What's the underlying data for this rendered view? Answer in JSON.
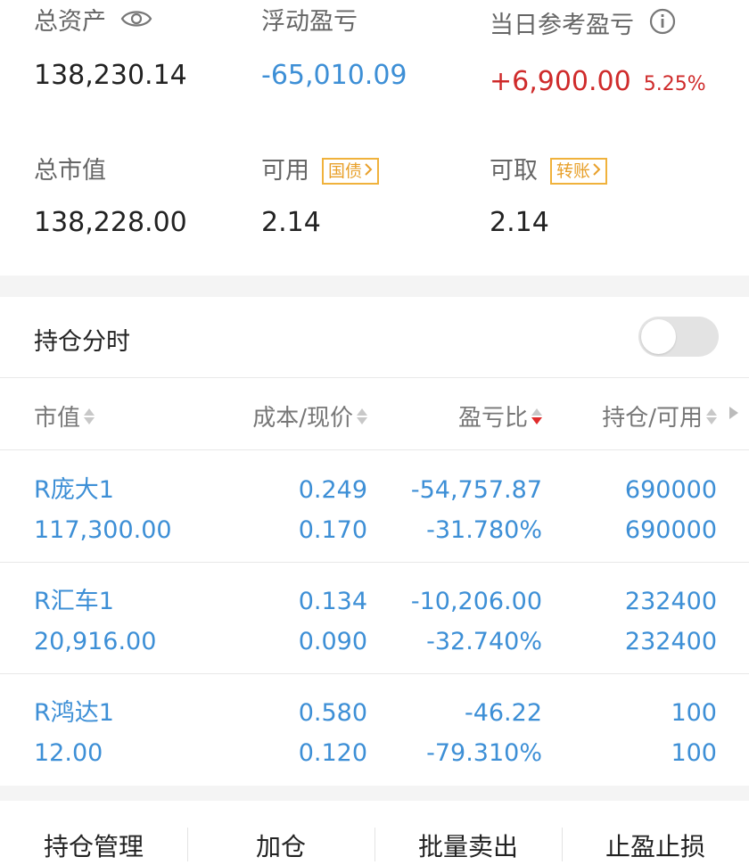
{
  "summary": {
    "total_assets": {
      "label": "总资产",
      "value": "138,230.14"
    },
    "floating_pnl": {
      "label": "浮动盈亏",
      "value": "-65,010.09"
    },
    "daily_pnl": {
      "label": "当日参考盈亏",
      "value": "+6,900.00",
      "percent": "5.25%"
    },
    "market_value": {
      "label": "总市值",
      "value": "138,228.00"
    },
    "available": {
      "label": "可用",
      "value": "2.14",
      "tag": "国债"
    },
    "withdrawable": {
      "label": "可取",
      "value": "2.14",
      "tag": "转账"
    }
  },
  "holdings": {
    "title": "持仓分时",
    "toggle_on": false,
    "headers": [
      "市值",
      "成本/现价",
      "盈亏比",
      "持仓/可用"
    ],
    "rows": [
      {
        "name": "R庞大1",
        "market_value": "117,300.00",
        "cost": "0.249",
        "price": "0.170",
        "pnl": "-54,757.87",
        "pnl_pct": "-31.780%",
        "hold": "690000",
        "avail": "690000"
      },
      {
        "name": "R汇车1",
        "market_value": "20,916.00",
        "cost": "0.134",
        "price": "0.090",
        "pnl": "-10,206.00",
        "pnl_pct": "-32.740%",
        "hold": "232400",
        "avail": "232400"
      },
      {
        "name": "R鸿达1",
        "market_value": "12.00",
        "cost": "0.580",
        "price": "0.120",
        "pnl": "-46.22",
        "pnl_pct": "-79.310%",
        "hold": "100",
        "avail": "100"
      }
    ]
  },
  "actions": [
    "持仓管理",
    "加仓",
    "批量卖出",
    "止盈止损"
  ],
  "colors": {
    "accent_blue": "#3d8fd6",
    "profit_red": "#cf2b2b",
    "tag_orange": "#e8a02a"
  }
}
